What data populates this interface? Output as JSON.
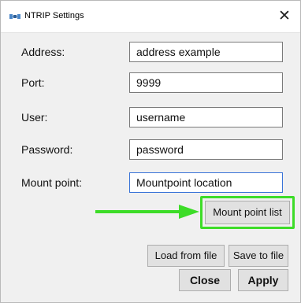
{
  "window": {
    "title": "NTRIP Settings",
    "close_glyph": "✕"
  },
  "fields": [
    {
      "label": "Address:",
      "value": "address example"
    },
    {
      "label": "Port:",
      "value": "9999"
    },
    {
      "label": "User:",
      "value": "username"
    },
    {
      "label": "Password:",
      "value": "password"
    },
    {
      "label": "Mount point:",
      "value": "Mountpoint location"
    }
  ],
  "buttons": {
    "mount_point_list": "Mount point list",
    "load_from_file": "Load from file",
    "save_to_file": "Save to file",
    "close": "Close",
    "apply": "Apply"
  },
  "annotation": {
    "color": "#3ddc28"
  }
}
